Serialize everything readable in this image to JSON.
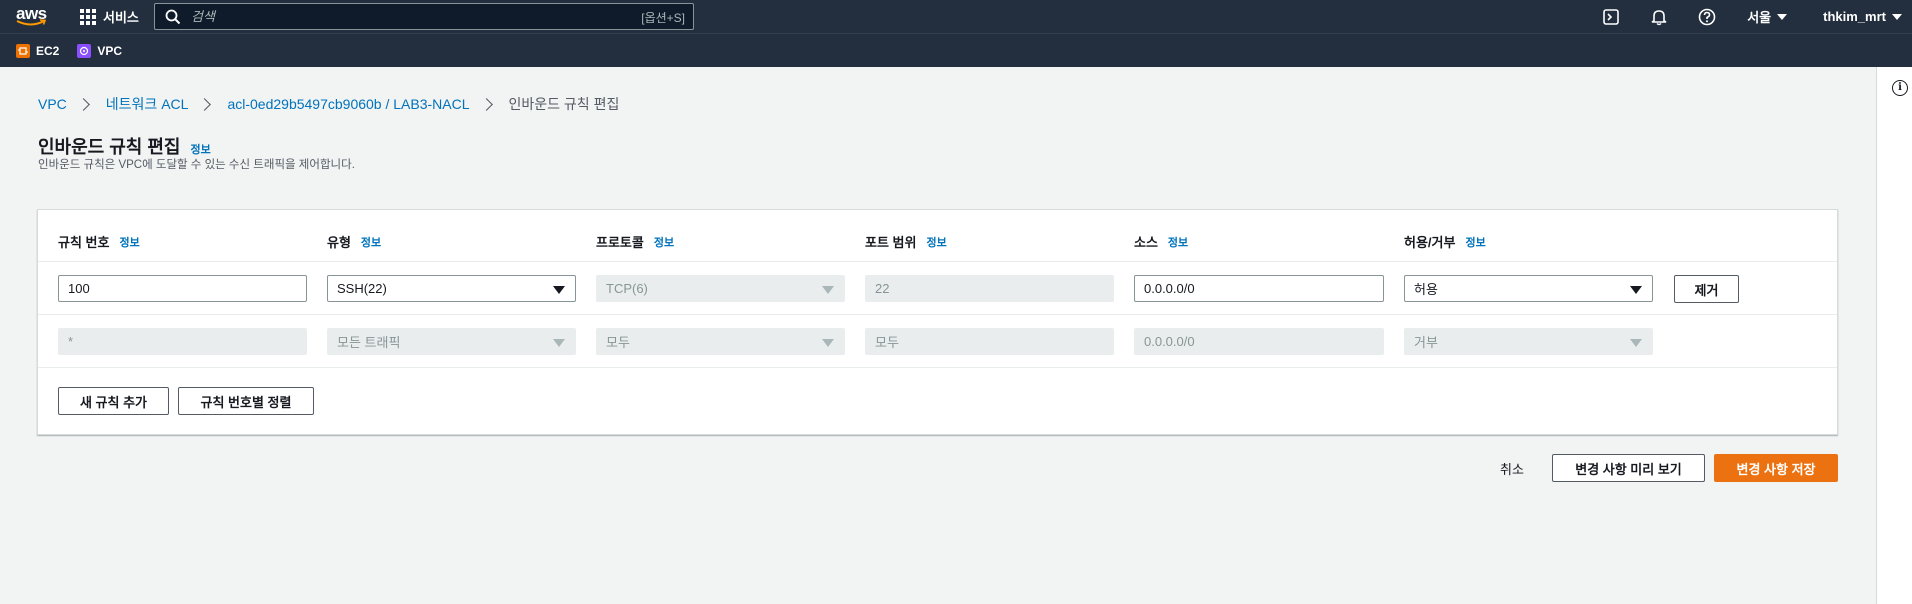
{
  "topnav": {
    "logo": "aws",
    "services_label": "서비스",
    "search_placeholder": "검색",
    "search_shortcut": "[옵션+S]",
    "region": "서울",
    "user": "thkim_mrt"
  },
  "favorites": [
    {
      "label": "EC2",
      "color": "#ed7100"
    },
    {
      "label": "VPC",
      "color": "#8c4fff"
    }
  ],
  "breadcrumb": {
    "items": [
      "VPC",
      "네트워크 ACL",
      "acl-0ed29b5497cb9060b / LAB3-NACL"
    ],
    "current": "인바운드 규칙 편집"
  },
  "page": {
    "title": "인바운드 규칙 편집",
    "info": "정보",
    "description": "인바운드 규칙은 VPC에 도달할 수 있는 수신 트래픽을 제어합니다."
  },
  "table": {
    "headers": [
      "규칙 번호",
      "유형",
      "프로토콜",
      "포트 범위",
      "소스",
      "허용/거부"
    ],
    "info": "정보",
    "rows": [
      {
        "rule": "100",
        "type": "SSH(22)",
        "protocol": "TCP(6)",
        "port": "22",
        "source": "0.0.0.0/0",
        "action": "허용",
        "remove": "제거"
      },
      {
        "rule": "*",
        "type": "모든 트래픽",
        "protocol": "모두",
        "port": "모두",
        "source": "0.0.0.0/0",
        "action": "거부"
      }
    ],
    "add_rule": "새 규칙 추가",
    "sort_rules": "규칙 번호별 정렬"
  },
  "footer": {
    "cancel": "취소",
    "preview": "변경 사항 미리 보기",
    "save": "변경 사항 저장"
  },
  "colors": {
    "nav_bg": "#232f3e",
    "link": "#0073bb",
    "primary": "#ec7211"
  }
}
